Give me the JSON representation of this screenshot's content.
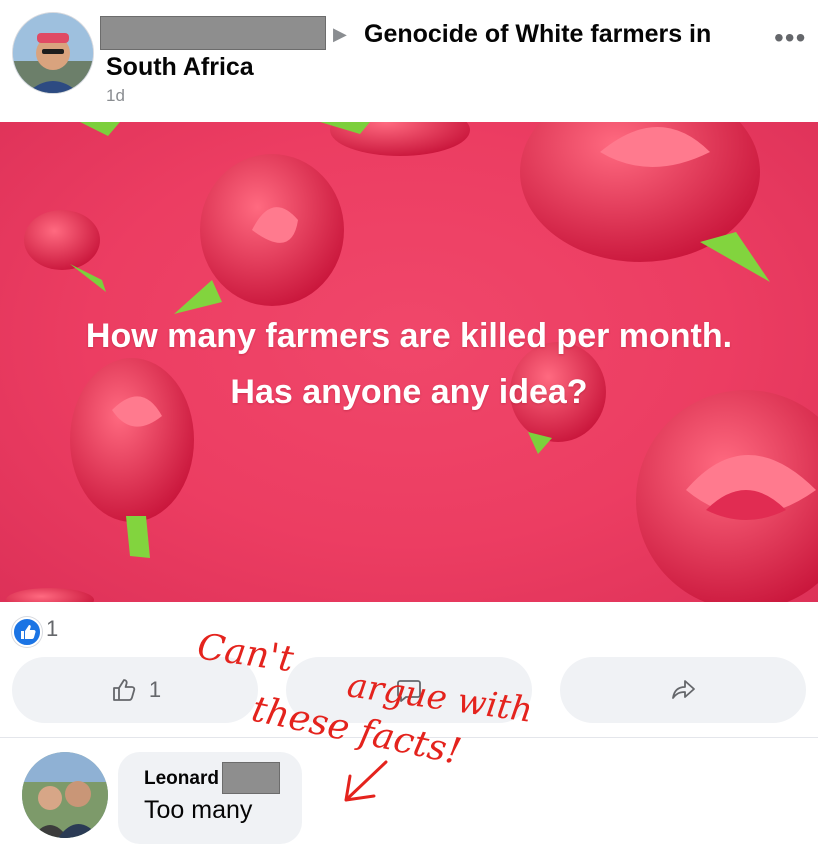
{
  "header": {
    "group_name_line1": "Genocide of White farmers in",
    "group_name_line2": "South Africa",
    "time_ago": "1d",
    "more_glyph": "•••",
    "arrow_glyph": "▶"
  },
  "post": {
    "line1": "How many farmers are killed per month.",
    "line2": "Has anyone any idea?",
    "background_color": "#ec3d62"
  },
  "reactions": {
    "count": "1",
    "like_button_count": "1"
  },
  "comment": {
    "author": "Leonard",
    "text": "Too many"
  },
  "annotation": {
    "line1": "Can't",
    "line2": "argue with",
    "line3": "these facts!",
    "color": "#e4231d"
  }
}
